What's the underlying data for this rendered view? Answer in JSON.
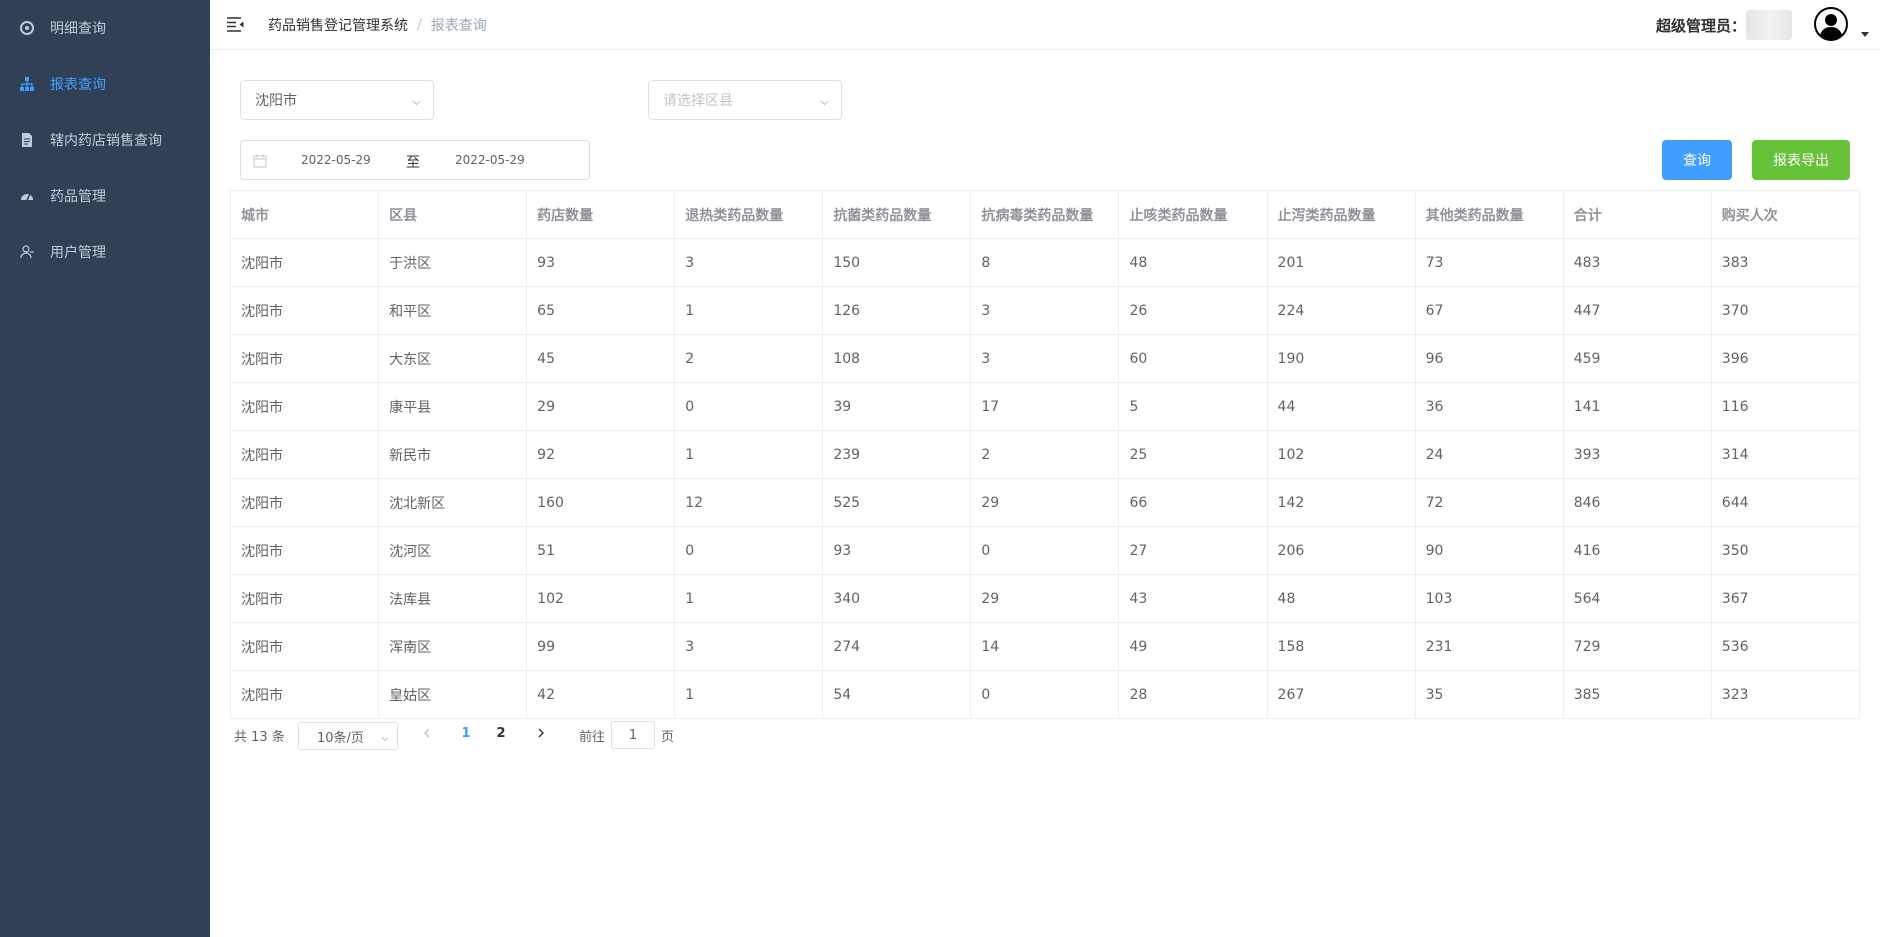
{
  "sidebar": {
    "items": [
      {
        "label": "明细查询",
        "icon": "aperture-icon",
        "active": false
      },
      {
        "label": "报表查询",
        "icon": "org-chart-icon",
        "active": true
      },
      {
        "label": "辖内药店销售查询",
        "icon": "document-icon",
        "active": false
      },
      {
        "label": "药品管理",
        "icon": "dashboard-icon",
        "active": false
      },
      {
        "label": "用户管理",
        "icon": "user-icon",
        "active": false
      }
    ]
  },
  "header": {
    "breadcrumb": [
      "药品销售登记管理系统",
      "报表查询"
    ],
    "user_label": "超级管理员："
  },
  "filters": {
    "city_value": "沈阳市",
    "district_placeholder": "请选择区县",
    "date_start": "2022-05-29",
    "date_separator": "至",
    "date_end": "2022-05-29",
    "query_label": "查询",
    "export_label": "报表导出"
  },
  "table": {
    "columns": [
      "城市",
      "区县",
      "药店数量",
      "退热类药品数量",
      "抗菌类药品数量",
      "抗病毒类药品数量",
      "止咳类药品数量",
      "止泻类药品数量",
      "其他类药品数量",
      "合计",
      "购买人次"
    ],
    "rows": [
      [
        "沈阳市",
        "于洪区",
        "93",
        "3",
        "150",
        "8",
        "48",
        "201",
        "73",
        "483",
        "383"
      ],
      [
        "沈阳市",
        "和平区",
        "65",
        "1",
        "126",
        "3",
        "26",
        "224",
        "67",
        "447",
        "370"
      ],
      [
        "沈阳市",
        "大东区",
        "45",
        "2",
        "108",
        "3",
        "60",
        "190",
        "96",
        "459",
        "396"
      ],
      [
        "沈阳市",
        "康平县",
        "29",
        "0",
        "39",
        "17",
        "5",
        "44",
        "36",
        "141",
        "116"
      ],
      [
        "沈阳市",
        "新民市",
        "92",
        "1",
        "239",
        "2",
        "25",
        "102",
        "24",
        "393",
        "314"
      ],
      [
        "沈阳市",
        "沈北新区",
        "160",
        "12",
        "525",
        "29",
        "66",
        "142",
        "72",
        "846",
        "644"
      ],
      [
        "沈阳市",
        "沈河区",
        "51",
        "0",
        "93",
        "0",
        "27",
        "206",
        "90",
        "416",
        "350"
      ],
      [
        "沈阳市",
        "法库县",
        "102",
        "1",
        "340",
        "29",
        "43",
        "48",
        "103",
        "564",
        "367"
      ],
      [
        "沈阳市",
        "浑南区",
        "99",
        "3",
        "274",
        "14",
        "49",
        "158",
        "231",
        "729",
        "536"
      ],
      [
        "沈阳市",
        "皇姑区",
        "42",
        "1",
        "54",
        "0",
        "28",
        "267",
        "35",
        "385",
        "323"
      ]
    ]
  },
  "pagination": {
    "total_text": "共 13 条",
    "page_size": "10条/页",
    "pages": [
      "1",
      "2"
    ],
    "current_page": "1",
    "goto_label": "前往",
    "goto_value": "1",
    "page_suffix": "页"
  },
  "colors": {
    "sidebar_bg": "#304156",
    "sidebar_text": "#bfcbd9",
    "accent": "#409eff",
    "success": "#67c23a"
  }
}
